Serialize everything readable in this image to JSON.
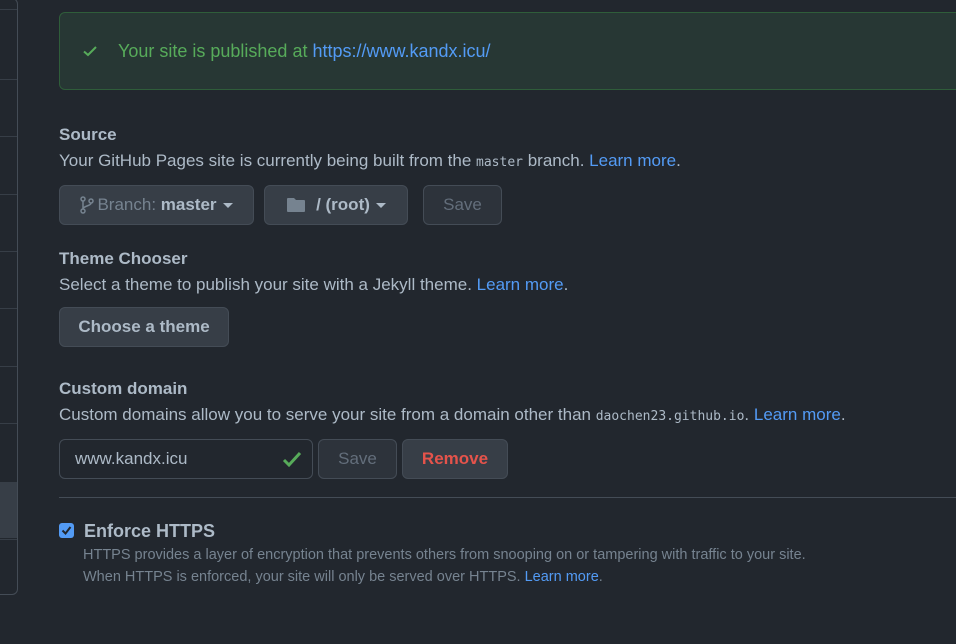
{
  "flash": {
    "text": "Your site is published at",
    "url": "https://www.kandx.icu/"
  },
  "source": {
    "heading": "Source",
    "text_before": "Your GitHub Pages site is currently being built from the ",
    "branch_code": "master",
    "text_after": " branch. ",
    "learn_more": "Learn more",
    "period": ".",
    "branch_label": "Branch:",
    "branch_value": "master",
    "folder_value": "/ (root)",
    "save_label": "Save"
  },
  "theme": {
    "heading": "Theme Chooser",
    "text": "Select a theme to publish your site with a Jekyll theme. ",
    "learn_more": "Learn more",
    "period": ".",
    "button_label": "Choose a theme"
  },
  "custom_domain": {
    "heading": "Custom domain",
    "text": "Custom domains allow you to serve your site from a domain other than ",
    "code": "daochen23.github.io",
    "text_after": ". ",
    "learn_more": "Learn more",
    "period": ".",
    "input_value": "www.kandx.icu",
    "save_label": "Save",
    "remove_label": "Remove"
  },
  "https": {
    "label": "Enforce HTTPS",
    "checked": true,
    "note_line1": "HTTPS provides a layer of encryption that prevents others from snooping on or tampering with traffic to your site.",
    "note_line2": "When HTTPS is enforced, your site will only be served over HTTPS. ",
    "learn_more": "Learn more",
    "period": "."
  },
  "colors": {
    "background": "#22272e",
    "success": "#57ab5a",
    "link": "#539bf5",
    "danger": "#e5534b"
  }
}
